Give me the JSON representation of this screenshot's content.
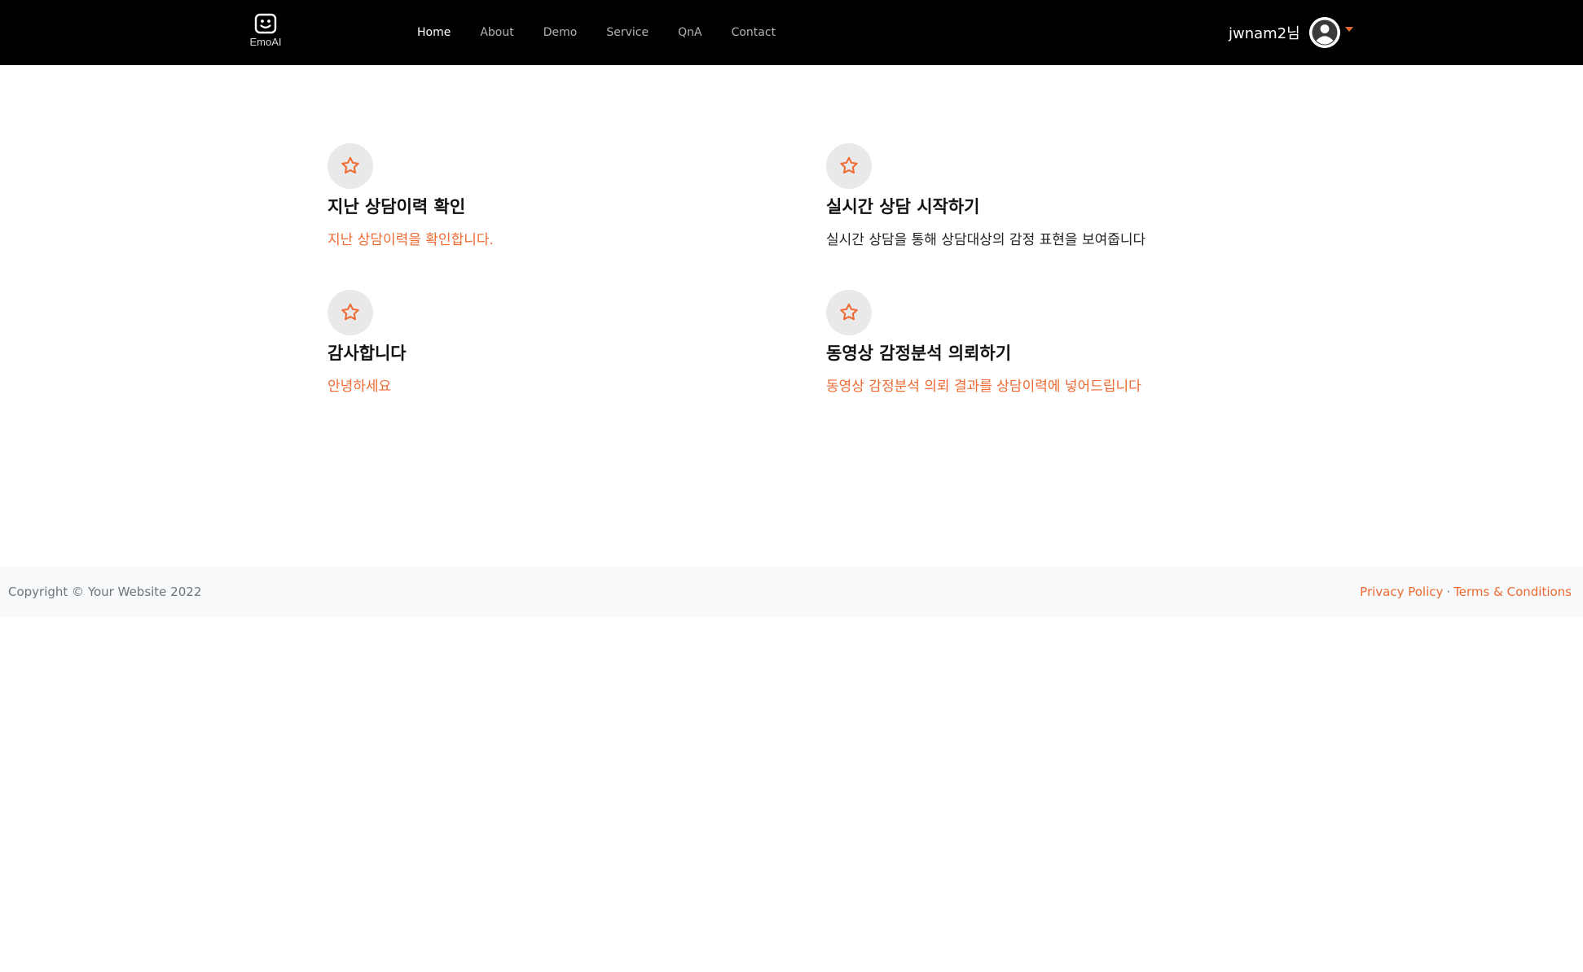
{
  "header": {
    "logo_text": "EmoAI",
    "logo_icon": "smiley-face-icon",
    "nav": [
      {
        "label": "Home",
        "active": true
      },
      {
        "label": "About",
        "active": false
      },
      {
        "label": "Demo",
        "active": false
      },
      {
        "label": "Service",
        "active": false
      },
      {
        "label": "QnA",
        "active": false
      },
      {
        "label": "Contact",
        "active": false
      }
    ],
    "user": {
      "name": "jwnam2님",
      "avatar_icon": "user-avatar-icon",
      "dropdown_icon": "caret-down-icon"
    }
  },
  "features": [
    {
      "icon": "star-icon",
      "title": "지난 상담이력 확인",
      "description": "지난 상담이력을 확인합니다."
    },
    {
      "icon": "star-icon",
      "title": "실시간 상담 시작하기",
      "description": "실시간 상담을 통해 상담대상의 감정 표현을 보여줍니다"
    },
    {
      "icon": "star-icon",
      "title": "감사합니다",
      "description": "안녕하세요"
    },
    {
      "icon": "star-icon",
      "title": "동영상 감정분석 의뢰하기",
      "description": "동영상 감정분석 의뢰 결과를 상담이력에 넣어드립니다"
    }
  ],
  "footer": {
    "copyright": "Copyright © Your Website 2022",
    "links": [
      "Privacy Policy",
      "Terms & Conditions"
    ],
    "separator": "·"
  },
  "colors": {
    "accent": "#ee6a32",
    "navbar_bg": "#000000",
    "footer_bg": "#f8f9fa"
  }
}
